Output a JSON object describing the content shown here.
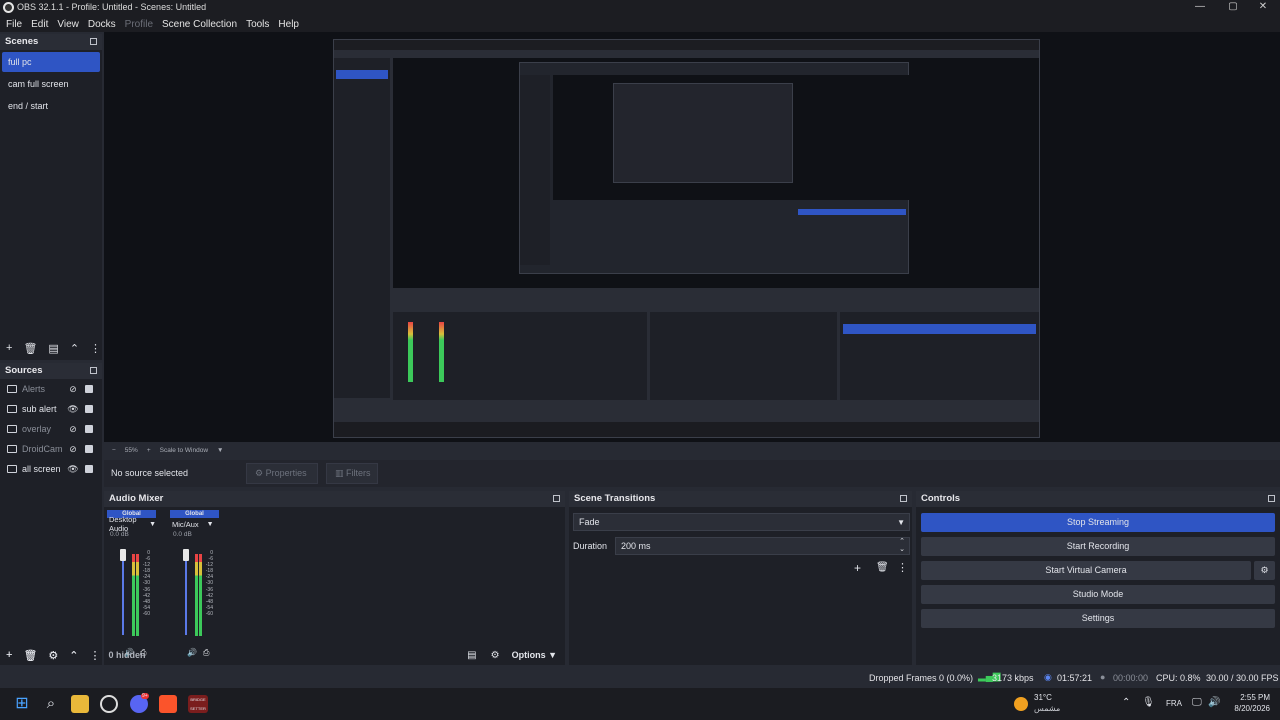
{
  "window": {
    "title": "OBS 32.1.1 - Profile: Untitled - Scenes: Untitled"
  },
  "menu": [
    {
      "label": "File",
      "disabled": false
    },
    {
      "label": "Edit",
      "disabled": false
    },
    {
      "label": "View",
      "disabled": false
    },
    {
      "label": "Docks",
      "disabled": false
    },
    {
      "label": "Profile",
      "disabled": true
    },
    {
      "label": "Scene Collection",
      "disabled": false
    },
    {
      "label": "Tools",
      "disabled": false
    },
    {
      "label": "Help",
      "disabled": false
    }
  ],
  "scenes": {
    "title": "Scenes",
    "items": [
      "full pc",
      "cam full screen",
      "end / start"
    ],
    "active_index": 0
  },
  "sources": {
    "title": "Sources",
    "items": [
      {
        "label": "Alerts",
        "visible": false
      },
      {
        "label": "sub alert",
        "visible": true
      },
      {
        "label": "overlay",
        "visible": false
      },
      {
        "label": "DroidCam",
        "visible": false
      },
      {
        "label": "all screen",
        "visible": true
      }
    ]
  },
  "preview_toolbar": {
    "minus": "−",
    "zoom": "55%",
    "plus": "+",
    "scale": "Scale to Window"
  },
  "properties_bar": {
    "no_source": "No source selected",
    "properties": "Properties",
    "filters": "Filters"
  },
  "audio_mixer": {
    "title": "Audio Mixer",
    "channels": [
      {
        "group": "Global",
        "name": "Desktop Audio",
        "db": "0.0 dB",
        "level": 0.55
      },
      {
        "group": "Global",
        "name": "Mic/Aux",
        "db": "0.0 dB",
        "level": 0.55
      }
    ],
    "ticks": [
      "0",
      "-6",
      "-12",
      "-18",
      "-24",
      "-30",
      "-36",
      "-42",
      "-48",
      "-54",
      "-60"
    ],
    "hidden_count": "0 hidden",
    "options": "Options"
  },
  "scene_transitions": {
    "title": "Scene Transitions",
    "transition": "Fade",
    "duration_label": "Duration",
    "duration_value": "200 ms"
  },
  "controls": {
    "title": "Controls",
    "stop_streaming": "Stop Streaming",
    "start_recording": "Start Recording",
    "start_virtual_camera": "Start Virtual Camera",
    "studio_mode": "Studio Mode",
    "settings": "Settings"
  },
  "status": {
    "dropped_frames": "Dropped Frames 0 (0.0%)",
    "bitrate": "3173 kbps",
    "stream_time": "01:57:21",
    "record_time": "00:00:00",
    "cpu": "CPU: 0.8%",
    "fps": "30.00 / 30.00 FPS"
  },
  "taskbar": {
    "weather_temp": "31°C",
    "weather_desc": "مشمس",
    "lang": "FRA",
    "time": "2:55 PM",
    "date": "8/20/2026",
    "badge_count": "9+",
    "app_label": "BRIDGE SETTER"
  },
  "colors": {
    "accent": "#2f55c4",
    "panel": "#1e2027",
    "header": "#2a2d36",
    "status_green": "#3cc95a"
  }
}
